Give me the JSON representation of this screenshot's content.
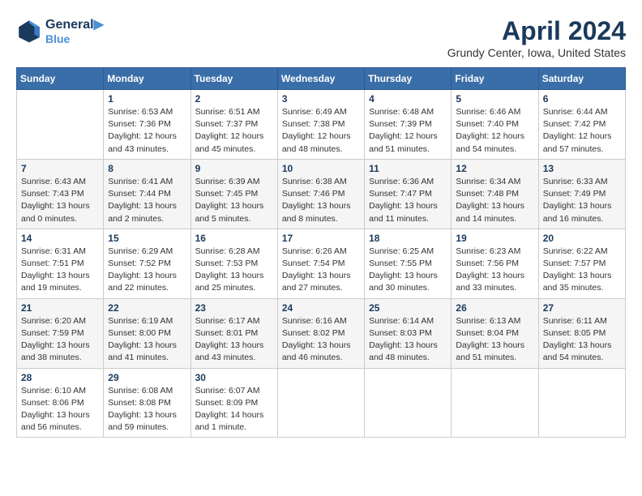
{
  "header": {
    "logo_line1": "General",
    "logo_line2": "Blue",
    "title": "April 2024",
    "subtitle": "Grundy Center, Iowa, United States"
  },
  "weekdays": [
    "Sunday",
    "Monday",
    "Tuesday",
    "Wednesday",
    "Thursday",
    "Friday",
    "Saturday"
  ],
  "weeks": [
    [
      {
        "num": "",
        "info": ""
      },
      {
        "num": "1",
        "info": "Sunrise: 6:53 AM\nSunset: 7:36 PM\nDaylight: 12 hours\nand 43 minutes."
      },
      {
        "num": "2",
        "info": "Sunrise: 6:51 AM\nSunset: 7:37 PM\nDaylight: 12 hours\nand 45 minutes."
      },
      {
        "num": "3",
        "info": "Sunrise: 6:49 AM\nSunset: 7:38 PM\nDaylight: 12 hours\nand 48 minutes."
      },
      {
        "num": "4",
        "info": "Sunrise: 6:48 AM\nSunset: 7:39 PM\nDaylight: 12 hours\nand 51 minutes."
      },
      {
        "num": "5",
        "info": "Sunrise: 6:46 AM\nSunset: 7:40 PM\nDaylight: 12 hours\nand 54 minutes."
      },
      {
        "num": "6",
        "info": "Sunrise: 6:44 AM\nSunset: 7:42 PM\nDaylight: 12 hours\nand 57 minutes."
      }
    ],
    [
      {
        "num": "7",
        "info": "Sunrise: 6:43 AM\nSunset: 7:43 PM\nDaylight: 13 hours\nand 0 minutes."
      },
      {
        "num": "8",
        "info": "Sunrise: 6:41 AM\nSunset: 7:44 PM\nDaylight: 13 hours\nand 2 minutes."
      },
      {
        "num": "9",
        "info": "Sunrise: 6:39 AM\nSunset: 7:45 PM\nDaylight: 13 hours\nand 5 minutes."
      },
      {
        "num": "10",
        "info": "Sunrise: 6:38 AM\nSunset: 7:46 PM\nDaylight: 13 hours\nand 8 minutes."
      },
      {
        "num": "11",
        "info": "Sunrise: 6:36 AM\nSunset: 7:47 PM\nDaylight: 13 hours\nand 11 minutes."
      },
      {
        "num": "12",
        "info": "Sunrise: 6:34 AM\nSunset: 7:48 PM\nDaylight: 13 hours\nand 14 minutes."
      },
      {
        "num": "13",
        "info": "Sunrise: 6:33 AM\nSunset: 7:49 PM\nDaylight: 13 hours\nand 16 minutes."
      }
    ],
    [
      {
        "num": "14",
        "info": "Sunrise: 6:31 AM\nSunset: 7:51 PM\nDaylight: 13 hours\nand 19 minutes."
      },
      {
        "num": "15",
        "info": "Sunrise: 6:29 AM\nSunset: 7:52 PM\nDaylight: 13 hours\nand 22 minutes."
      },
      {
        "num": "16",
        "info": "Sunrise: 6:28 AM\nSunset: 7:53 PM\nDaylight: 13 hours\nand 25 minutes."
      },
      {
        "num": "17",
        "info": "Sunrise: 6:26 AM\nSunset: 7:54 PM\nDaylight: 13 hours\nand 27 minutes."
      },
      {
        "num": "18",
        "info": "Sunrise: 6:25 AM\nSunset: 7:55 PM\nDaylight: 13 hours\nand 30 minutes."
      },
      {
        "num": "19",
        "info": "Sunrise: 6:23 AM\nSunset: 7:56 PM\nDaylight: 13 hours\nand 33 minutes."
      },
      {
        "num": "20",
        "info": "Sunrise: 6:22 AM\nSunset: 7:57 PM\nDaylight: 13 hours\nand 35 minutes."
      }
    ],
    [
      {
        "num": "21",
        "info": "Sunrise: 6:20 AM\nSunset: 7:59 PM\nDaylight: 13 hours\nand 38 minutes."
      },
      {
        "num": "22",
        "info": "Sunrise: 6:19 AM\nSunset: 8:00 PM\nDaylight: 13 hours\nand 41 minutes."
      },
      {
        "num": "23",
        "info": "Sunrise: 6:17 AM\nSunset: 8:01 PM\nDaylight: 13 hours\nand 43 minutes."
      },
      {
        "num": "24",
        "info": "Sunrise: 6:16 AM\nSunset: 8:02 PM\nDaylight: 13 hours\nand 46 minutes."
      },
      {
        "num": "25",
        "info": "Sunrise: 6:14 AM\nSunset: 8:03 PM\nDaylight: 13 hours\nand 48 minutes."
      },
      {
        "num": "26",
        "info": "Sunrise: 6:13 AM\nSunset: 8:04 PM\nDaylight: 13 hours\nand 51 minutes."
      },
      {
        "num": "27",
        "info": "Sunrise: 6:11 AM\nSunset: 8:05 PM\nDaylight: 13 hours\nand 54 minutes."
      }
    ],
    [
      {
        "num": "28",
        "info": "Sunrise: 6:10 AM\nSunset: 8:06 PM\nDaylight: 13 hours\nand 56 minutes."
      },
      {
        "num": "29",
        "info": "Sunrise: 6:08 AM\nSunset: 8:08 PM\nDaylight: 13 hours\nand 59 minutes."
      },
      {
        "num": "30",
        "info": "Sunrise: 6:07 AM\nSunset: 8:09 PM\nDaylight: 14 hours\nand 1 minute."
      },
      {
        "num": "",
        "info": ""
      },
      {
        "num": "",
        "info": ""
      },
      {
        "num": "",
        "info": ""
      },
      {
        "num": "",
        "info": ""
      }
    ]
  ]
}
